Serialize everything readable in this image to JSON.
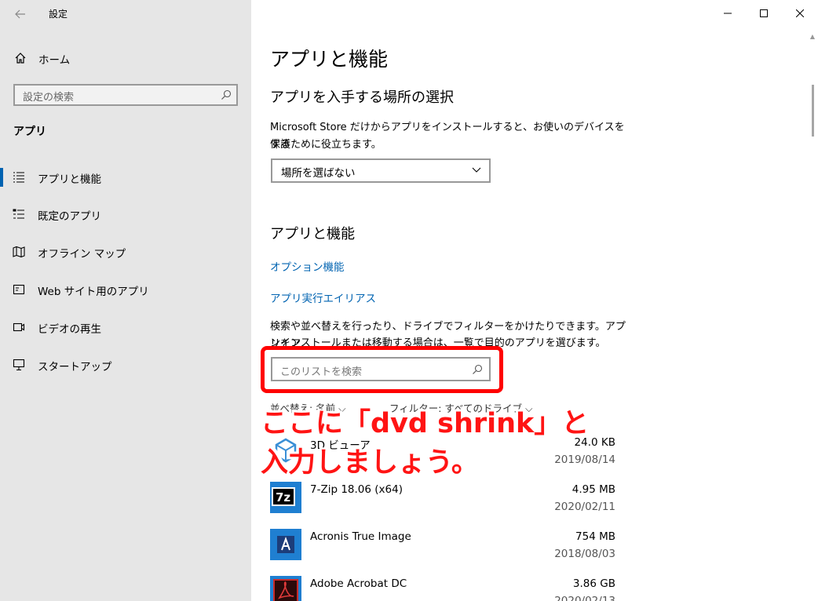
{
  "window": {
    "title": "設定"
  },
  "sidebar": {
    "home_label": "ホーム",
    "search_placeholder": "設定の検索",
    "section_heading": "アプリ",
    "items": [
      {
        "label": "アプリと機能",
        "icon": "list-icon",
        "active": true
      },
      {
        "label": "既定のアプリ",
        "icon": "default-apps-icon",
        "active": false
      },
      {
        "label": "オフライン マップ",
        "icon": "map-icon",
        "active": false
      },
      {
        "label": "Web サイト用のアプリ",
        "icon": "website-app-icon",
        "active": false
      },
      {
        "label": "ビデオの再生",
        "icon": "video-icon",
        "active": false
      },
      {
        "label": "スタートアップ",
        "icon": "startup-icon",
        "active": false
      }
    ]
  },
  "main": {
    "page_title": "アプリと機能",
    "install_source": {
      "heading": "アプリを入手する場所の選択",
      "description_line1": "Microsoft Store だけからアプリをインストールすると、お使いのデバイスを保護",
      "description_line2": "するために役立ちます。",
      "dropdown_value": "場所を選ばない"
    },
    "apps_features": {
      "heading": "アプリと機能",
      "link_optional": "オプション機能",
      "link_alias": "アプリ実行エイリアス",
      "description_line1": "検索や並べ替えを行ったり、ドライブでフィルターをかけたりできます。アプリをア",
      "description_line2": "ンインストールまたは移動する場合は、一覧で目的のアプリを選びます。",
      "list_search_placeholder": "このリストを検索",
      "sort_label": "並べ替え: 名前",
      "filter_label": "フィルター: すべてのドライブ"
    },
    "apps": [
      {
        "name": "3D ビューア",
        "size": "24.0 KB",
        "date": "2019/08/14",
        "icon": "3d-viewer-icon"
      },
      {
        "name": "7-Zip 18.06 (x64)",
        "size": "4.95 MB",
        "date": "2020/02/11",
        "icon": "7zip-icon"
      },
      {
        "name": "Acronis True Image",
        "size": "754 MB",
        "date": "2018/08/03",
        "icon": "acronis-icon"
      },
      {
        "name": "Adobe Acrobat DC",
        "size": "3.86 GB",
        "date": "2020/02/13",
        "icon": "acrobat-icon"
      }
    ]
  },
  "annotation": {
    "line1": "ここに「dvd shrink」と",
    "line2": "入力しましょう。"
  },
  "colors": {
    "accent": "#0063b1",
    "highlight": "#ff0000",
    "sidebar_bg": "#e6e6e6"
  }
}
